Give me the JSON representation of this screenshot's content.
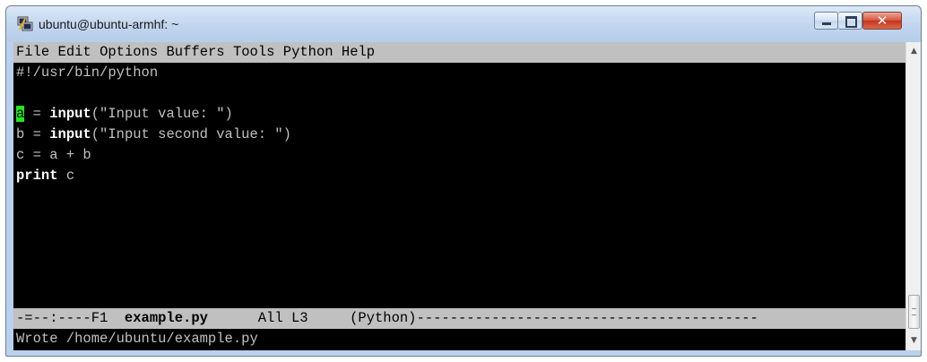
{
  "window": {
    "title": "ubuntu@ubuntu-armhf: ~",
    "icon": "putty-terminal-icon",
    "controls": {
      "minimize": "minimize-icon",
      "maximize": "maximize-icon",
      "close": "close-icon",
      "close_glyph": "✕"
    }
  },
  "menubar": {
    "items": [
      "File",
      "Edit",
      "Options",
      "Buffers",
      "Tools",
      "Python",
      "Help"
    ]
  },
  "editor": {
    "lines": {
      "l0": "#!/usr/bin/python",
      "l1": "",
      "l2_cursor": "a",
      "l2_mid": " = ",
      "l2_kw": "input",
      "l2_rest": "(\"Input value: \")",
      "l3_pre": "b = ",
      "l3_kw": "input",
      "l3_rest": "(\"Input second value: \")",
      "l4": "c = a + b",
      "l5_kw": "print",
      "l5_rest": " c"
    }
  },
  "modeline": {
    "prefix": "-=--:----F1  ",
    "filename": "example.py",
    "position": "      All L3     (Python)",
    "fill": "-----------------------------------------"
  },
  "echo_area": {
    "message": "Wrote /home/ubuntu/example.py"
  },
  "colors": {
    "terminal_bg": "#000000",
    "text": "#c0c0c0",
    "cursor": "#22e822",
    "modeline_bg": "#c0c0c0"
  }
}
